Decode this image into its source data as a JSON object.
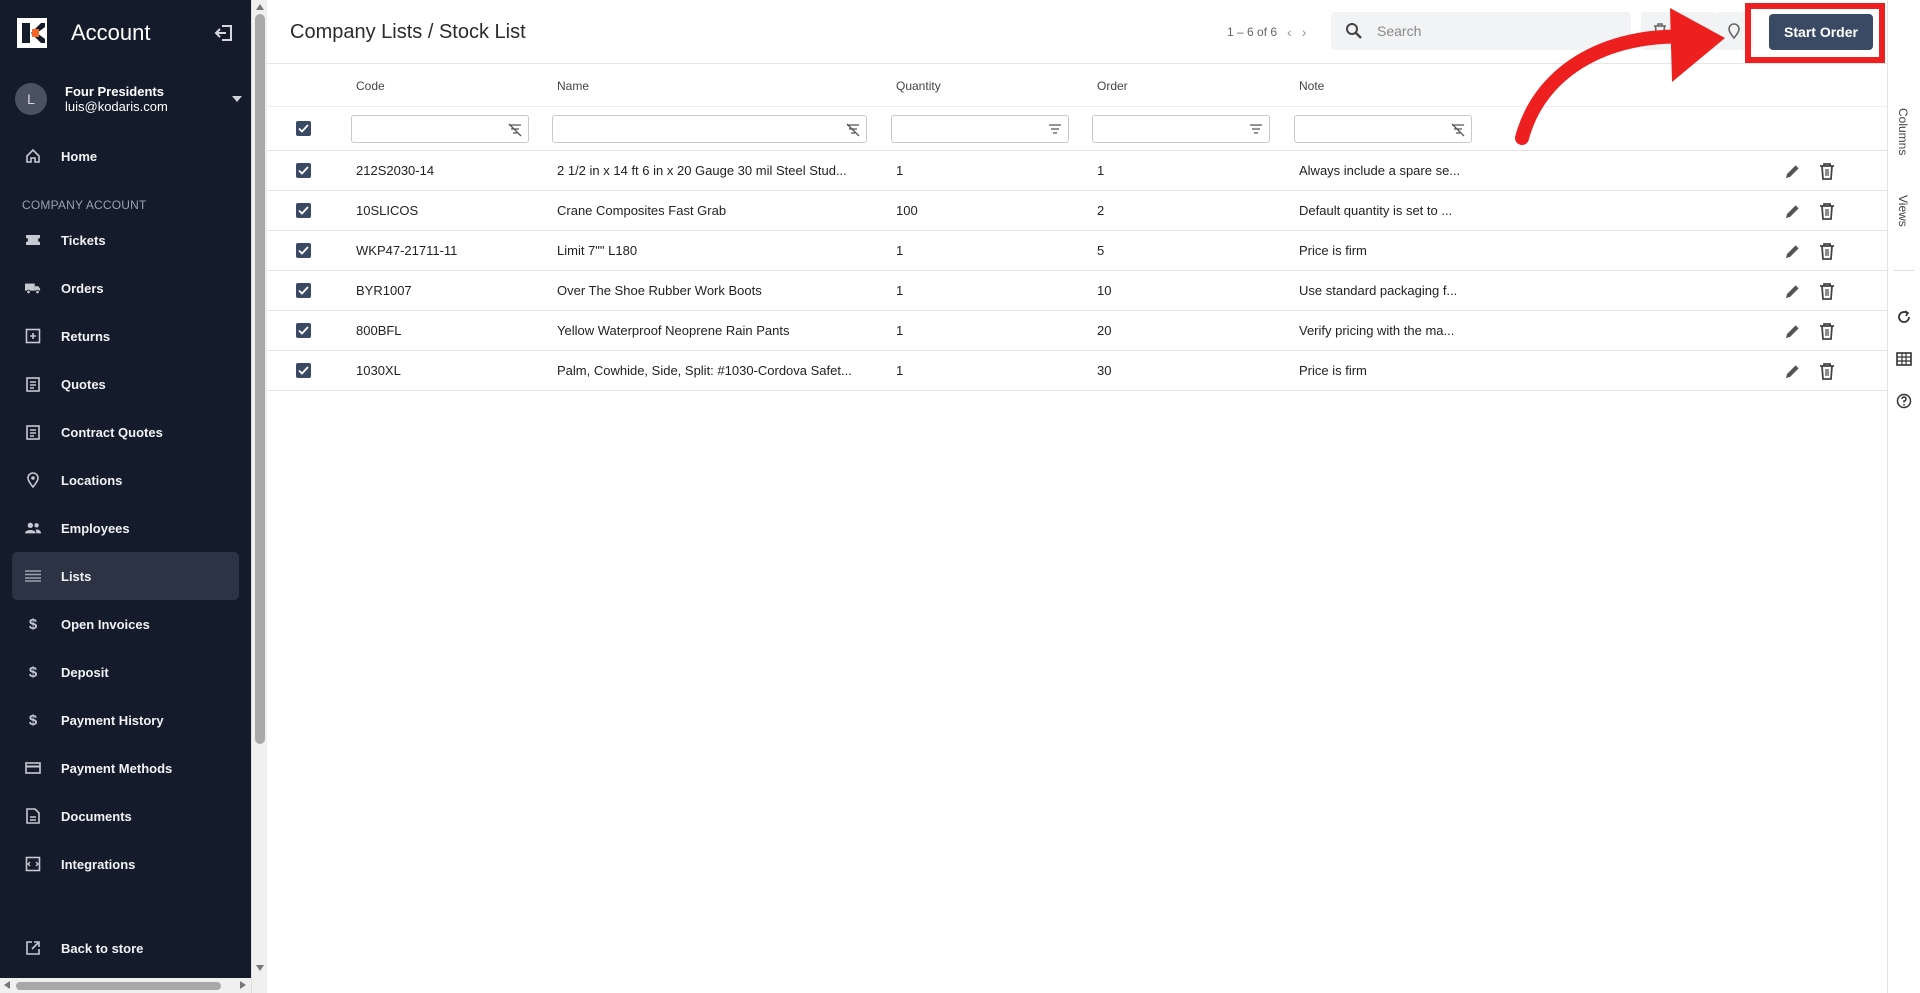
{
  "sidebar": {
    "title": "Account",
    "user": {
      "avatar_letter": "L",
      "name": "Four Presidents",
      "email": "luis@kodaris.com"
    },
    "items": [
      {
        "label": "Home",
        "icon": "home-icon"
      }
    ],
    "section_label": "COMPANY ACCOUNT",
    "section_items": [
      {
        "label": "Tickets",
        "icon": "ticket-icon"
      },
      {
        "label": "Orders",
        "icon": "truck-icon"
      },
      {
        "label": "Returns",
        "icon": "return-box-icon"
      },
      {
        "label": "Quotes",
        "icon": "clipboard-icon"
      },
      {
        "label": "Contract Quotes",
        "icon": "clipboard-icon"
      },
      {
        "label": "Locations",
        "icon": "location-pin-icon"
      },
      {
        "label": "Employees",
        "icon": "people-icon"
      },
      {
        "label": "Lists",
        "icon": "list-icon",
        "active": true
      },
      {
        "label": "Open Invoices",
        "icon": "dollar-icon"
      },
      {
        "label": "Deposit",
        "icon": "dollar-icon"
      },
      {
        "label": "Payment History",
        "icon": "dollar-icon"
      },
      {
        "label": "Payment Methods",
        "icon": "credit-card-icon"
      },
      {
        "label": "Documents",
        "icon": "document-icon"
      },
      {
        "label": "Integrations",
        "icon": "integration-icon"
      }
    ],
    "back_to_store": "Back to store"
  },
  "header": {
    "title": "Company Lists / Stock List",
    "pagination": "1 – 6 of 6",
    "search_placeholder": "Search",
    "start_order_label": "Start Order"
  },
  "table": {
    "columns": [
      "Code",
      "Name",
      "Quantity",
      "Order",
      "Note"
    ],
    "rows": [
      {
        "code": "212S2030-14",
        "name": "2 1/2 in x 14 ft 6 in x 20 Gauge 30 mil Steel Stud...",
        "quantity": "1",
        "order": "1",
        "note": "Always include a spare se..."
      },
      {
        "code": "10SLICOS",
        "name": "Crane Composites Fast Grab",
        "quantity": "100",
        "order": "2",
        "note": "Default quantity is set to ..."
      },
      {
        "code": "WKP47-21711-11",
        "name": "Limit 7\"\" L180",
        "quantity": "1",
        "order": "5",
        "note": "Price is firm"
      },
      {
        "code": "BYR1007",
        "name": "Over The Shoe Rubber Work Boots",
        "quantity": "1",
        "order": "10",
        "note": "Use standard packaging f..."
      },
      {
        "code": "800BFL",
        "name": "Yellow Waterproof Neoprene Rain Pants",
        "quantity": "1",
        "order": "20",
        "note": "Verify pricing with the ma..."
      },
      {
        "code": "1030XL",
        "name": "Palm, Cowhide, Side, Split: #1030-Cordova Safet...",
        "quantity": "1",
        "order": "30",
        "note": "Price is firm"
      }
    ]
  },
  "rail": {
    "columns_label": "Columns",
    "views_label": "Views"
  },
  "colors": {
    "sidebar_bg": "#141b2b",
    "accent": "#3b4a64",
    "annotation": "#ee1f1f"
  }
}
